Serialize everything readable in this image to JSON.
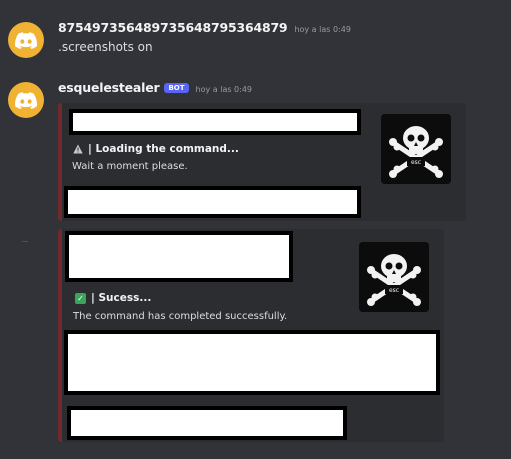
{
  "messages": [
    {
      "username": "875497356489735648795364879",
      "timestamp": "hoy a las 0:49",
      "content": ".screenshots on"
    },
    {
      "username": "esquelestealer",
      "bot_tag": "BOT",
      "timestamp": "hoy a las 0:49",
      "embeds": [
        {
          "title_icon": "warning-icon",
          "title": "| Loading the command...",
          "description": "Wait a moment please.",
          "thumbnail_label": "esc"
        },
        {
          "title_icon": "check-icon",
          "title": "| Sucess...",
          "description": "The command has completed successfully.",
          "thumbnail_label": "esc"
        }
      ]
    }
  ],
  "colors": {
    "background": "#313338",
    "embed_background": "#2b2d31",
    "embed_border": "#6e2a2c",
    "avatar": "#f0b232",
    "bot_tag": "#5865f2",
    "check": "#3ba55c"
  }
}
